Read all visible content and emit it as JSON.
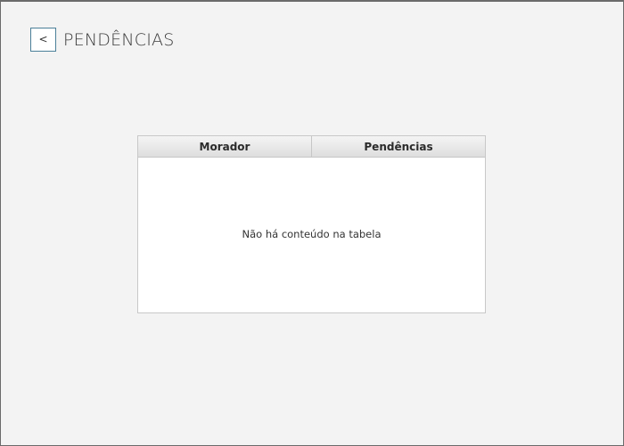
{
  "header": {
    "back_label": "<",
    "title": "PENDÊNCIAS"
  },
  "table": {
    "columns": [
      "Morador",
      "Pendências"
    ],
    "rows": [],
    "empty_message": "Não há conteúdo na tabela"
  }
}
